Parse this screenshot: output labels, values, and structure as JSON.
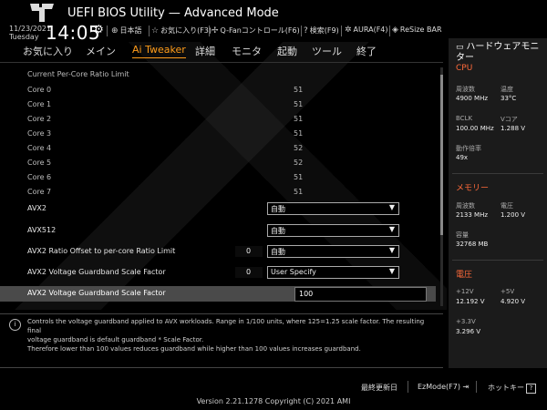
{
  "header": {
    "title": "UEFI BIOS Utility — Advanced Mode",
    "date": "11/23/2021",
    "day": "Tuesday",
    "time": "14:05",
    "items": [
      {
        "icon": "globe-icon",
        "label": "日本語"
      },
      {
        "icon": "star-icon",
        "label": "お気に入り(F3)"
      },
      {
        "icon": "fan-icon",
        "label": "Q-Fanコントロール(F6)"
      },
      {
        "icon": "help-icon",
        "label": "検索(F9)"
      },
      {
        "icon": "aura-icon",
        "label": "AURA(F4)"
      },
      {
        "icon": "resize-bar-icon",
        "label": "ReSize BAR"
      }
    ]
  },
  "menu": [
    "お気に入り",
    "メイン",
    "Ai Tweaker",
    "詳細",
    "モニタ",
    "起動",
    "ツール",
    "終了"
  ],
  "content": {
    "section_title": "Current Per-Core Ratio Limit",
    "cores": [
      {
        "label": "Core 0",
        "value": "51"
      },
      {
        "label": "Core 1",
        "value": "51"
      },
      {
        "label": "Core 2",
        "value": "51"
      },
      {
        "label": "Core 3",
        "value": "51"
      },
      {
        "label": "Core 4",
        "value": "52"
      },
      {
        "label": "Core 5",
        "value": "52"
      },
      {
        "label": "Core 6",
        "value": "51"
      },
      {
        "label": "Core 7",
        "value": "51"
      }
    ],
    "settings": [
      {
        "label": "AVX2",
        "num": "",
        "value": "自動"
      },
      {
        "label": "AVX512",
        "num": "",
        "value": "自動"
      },
      {
        "label": "AVX2 Ratio Offset to per-core Ratio Limit",
        "num": "0",
        "value": "自動"
      },
      {
        "label": "AVX2 Voltage Guardband Scale Factor",
        "num": "0",
        "value": "User Specify"
      }
    ],
    "selected": {
      "label": "AVX2 Voltage Guardband Scale Factor",
      "value": "100"
    }
  },
  "help": {
    "line1": "Controls the voltage guardband applied to AVX workloads. Range in 1/100 units, where 125=1.25 scale factor. The resulting final",
    "line2": "voltage guardband is default guardband * Scale Factor.",
    "line3": "Therefore lower than 100 values reduces guardband while higher than 100 values increases guardband."
  },
  "hw": {
    "title": "ハードウェアモニター",
    "cpu": {
      "section": "CPU",
      "freq_label": "周波数",
      "freq": "4900 MHz",
      "temp_label": "温度",
      "temp": "33°C",
      "bclk_label": "BCLK",
      "bclk": "100.00 MHz",
      "vcore_label": "Vコア",
      "vcore": "1.288 V",
      "ratio_label": "動作倍率",
      "ratio": "49x"
    },
    "memory": {
      "section": "メモリー",
      "freq_label": "周波数",
      "freq": "2133 MHz",
      "volt_label": "電圧",
      "volt": "1.200 V",
      "cap_label": "容量",
      "cap": "32768 MB"
    },
    "voltage": {
      "section": "電圧",
      "v12_label": "+12V",
      "v12": "12.192 V",
      "v5_label": "+5V",
      "v5": "4.920 V",
      "v33_label": "+3.3V",
      "v33": "3.296 V"
    }
  },
  "footer": {
    "last_modified": "最終更新日",
    "ezmode": "EzMode(F7)",
    "hotkeys": "ホットキー",
    "version": "Version 2.21.1278 Copyright (C) 2021 AMI"
  },
  "colors": {
    "accent": "#ff9c1a",
    "section": "#ff6a3a"
  }
}
